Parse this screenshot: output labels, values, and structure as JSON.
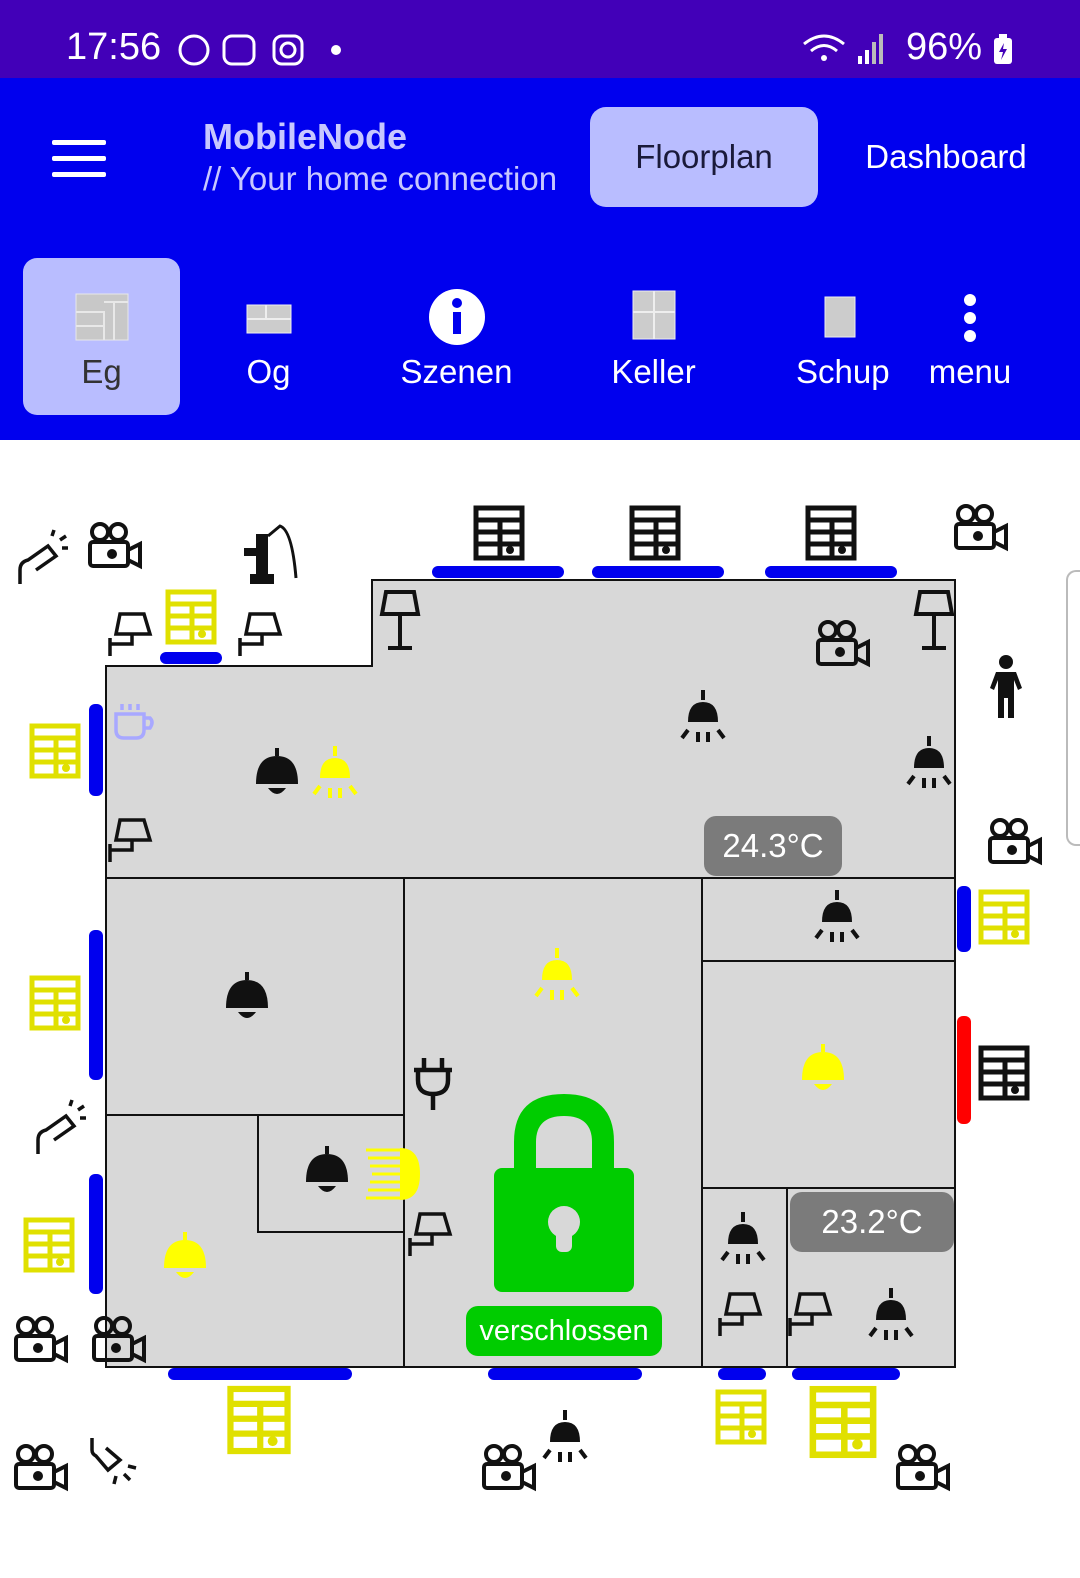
{
  "status": {
    "time": "17:56",
    "battery": "96%"
  },
  "header": {
    "title": "MobileNode",
    "subtitle": "// Your home connection",
    "floorplan_label": "Floorplan",
    "dashboard_label": "Dashboard"
  },
  "tabs": [
    {
      "label": "Eg",
      "icon": "floor-eg-icon",
      "active": true
    },
    {
      "label": "Og",
      "icon": "floor-og-icon"
    },
    {
      "label": "Szenen",
      "icon": "info-icon"
    },
    {
      "label": "Keller",
      "icon": "floor-keller-icon"
    },
    {
      "label": "Schup",
      "icon": "floor-schup-icon"
    },
    {
      "label": "menu",
      "icon": "more-vert-icon"
    }
  ],
  "floorplan": {
    "temperatures": [
      "24.3°C",
      "23.2°C"
    ],
    "lock_status": "verschlossen"
  },
  "colors": {
    "accent": "#0000ee",
    "status_bar": "#4200b8",
    "active_tab": "#b9bdff",
    "on": "#ffff00",
    "window_open": "#ffff00",
    "shutter": "#0000ee",
    "alarm": "#ff0000",
    "lock": "#00cc00"
  }
}
